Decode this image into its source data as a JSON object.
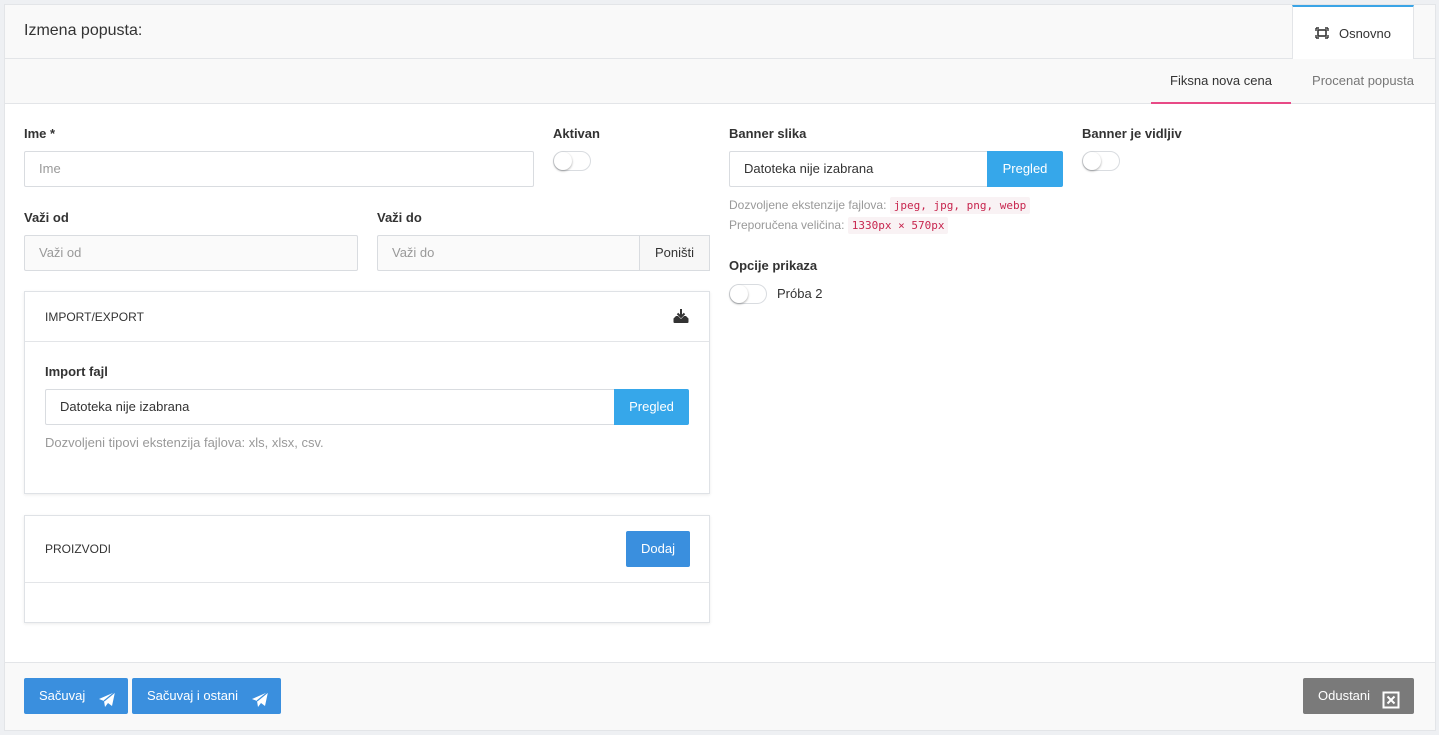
{
  "header": {
    "title": "Izmena popusta:",
    "tab_label": "Osnovno",
    "tab_icon": "expand-icon"
  },
  "subtabs": [
    {
      "label": "Fiksna nova cena",
      "active": true
    },
    {
      "label": "Procenat popusta",
      "active": false
    }
  ],
  "form": {
    "name_label": "Ime *",
    "name_placeholder": "Ime",
    "active_label": "Aktivan",
    "active_on": false,
    "valid_from_label": "Važi od",
    "valid_from_placeholder": "Važi od",
    "valid_to_label": "Važi do",
    "valid_to_placeholder": "Važi do",
    "reset_label": "Poništi",
    "banner_label": "Banner slika",
    "banner_file_text": "Datoteka nije izabrana",
    "banner_browse": "Pregled",
    "banner_ext_label": "Dozvoljene ekstenzije fajlova:",
    "banner_ext_value": "jpeg, jpg, png, webp",
    "banner_size_label": "Preporučena veličina:",
    "banner_size_value": "1330px × 570px",
    "banner_visible_label": "Banner je vidljiv",
    "banner_visible_on": false,
    "display_options_label": "Opcije prikaza",
    "display_option_1": "Próba 2",
    "display_option_1_on": false
  },
  "import_panel": {
    "title": "IMPORT/EXPORT",
    "file_label": "Import fajl",
    "file_text": "Datoteka nije izabrana",
    "browse": "Pregled",
    "help": "Dozvoljeni tipovi ekstenzija fajlova: xls, xlsx, csv."
  },
  "products_panel": {
    "title": "PROIZVODI",
    "add_label": "Dodaj"
  },
  "footer": {
    "save_label": "Sačuvaj",
    "save_stay_label": "Sačuvaj i ostani",
    "cancel_label": "Odustani"
  },
  "colors": {
    "primary": "#3a8fde",
    "browse": "#36a7ea",
    "tab_active_underline": "#e84a86",
    "cancel": "#7a7a7a"
  }
}
